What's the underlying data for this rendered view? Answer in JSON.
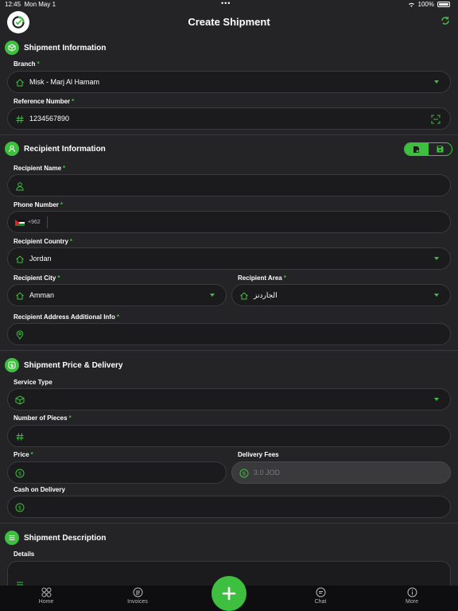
{
  "status": {
    "time": "12:45",
    "date": "Mon May 1",
    "battery": "100%"
  },
  "header": {
    "title": "Create Shipment"
  },
  "shipment_info": {
    "title": "Shipment Information",
    "branch_label": "Branch",
    "branch_value": "Misk - Marj Al Hamam",
    "reference_label": "Reference Number",
    "reference_value": "1234567890"
  },
  "recipient": {
    "title": "Recipient Information",
    "name_label": "Recipient Name",
    "name_value": "",
    "phone_label": "Phone Number",
    "phone_code": "+962",
    "phone_value": "",
    "country_label": "Recipient Country",
    "country_value": "Jordan",
    "city_label": "Recipient City",
    "city_value": "Amman",
    "area_label": "Recipient Area",
    "area_value": "الجاردنز",
    "address_label": "Recipient Address Additional Info",
    "address_value": ""
  },
  "price_delivery": {
    "title": "Shipment Price & Delivery",
    "service_label": "Service Type",
    "service_value": "",
    "pieces_label": "Number of Pieces",
    "pieces_value": "",
    "price_label": "Price",
    "price_value": "",
    "fees_label": "Delivery Fees",
    "fees_placeholder": "3.0 JOD",
    "cod_label": "Cash on Delivery",
    "cod_value": ""
  },
  "description": {
    "title": "Shipment Description",
    "details_label": "Details"
  },
  "required_marker": "*",
  "tabbar": {
    "home": "Home",
    "invoices": "Invoices",
    "chat": "Chat",
    "more": "More"
  },
  "colors": {
    "accent": "#3fbf3f",
    "background": "#242427",
    "field": "#1b1b1e"
  }
}
